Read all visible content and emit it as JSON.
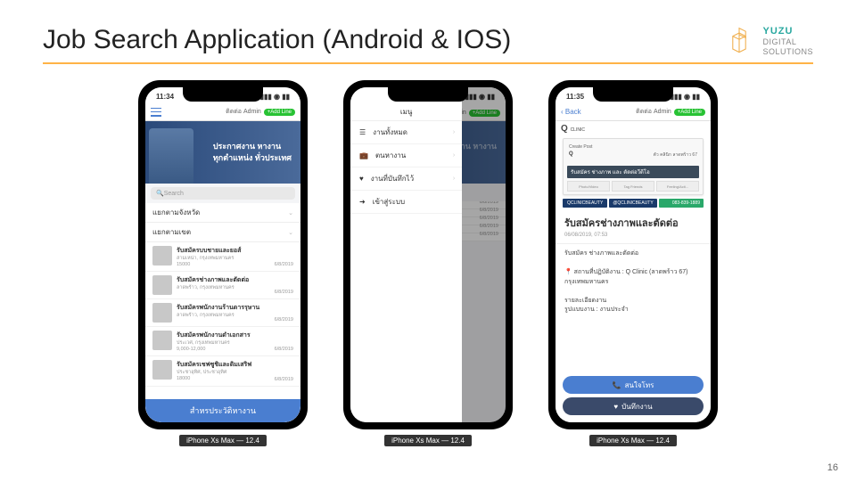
{
  "slide": {
    "title": "Job Search Application (Android & IOS)",
    "page_number": "16"
  },
  "logo": {
    "brand": "YUZU",
    "sub": "DIGITAL\nSOLUTIONS"
  },
  "phone_label": "iPhone Xs Max — 12.4",
  "status": {
    "time1": "11:34",
    "time2": "11:35",
    "time3": "11:35"
  },
  "navbar": {
    "contact": "ติดต่อ Admin",
    "add": "+Add Line",
    "back": "Back",
    "menu_title": "เมนู"
  },
  "hero": {
    "line1": "ประกาศงาน หางาน",
    "line2": "ทุกตำแหน่ง ทั่วประเทศ"
  },
  "search": {
    "placeholder": "Search"
  },
  "filters": {
    "province": "แยกตามจังหวัด",
    "district": "แยกตามเขต"
  },
  "jobs": [
    {
      "title": "รับสมัครบบชายและยอส์",
      "sub": "สามเหน่า, กรุงเทพมหานคร",
      "salary": "15000",
      "date": "6/8/2019"
    },
    {
      "title": "รับสมัครช่างภาพและตัดต่อ",
      "sub": "ลาดพร้าว, กรุงเทพมหานคร",
      "salary": "",
      "date": "6/8/2019"
    },
    {
      "title": "รับสมัครพนักงานร้านดารรุษาน",
      "sub": "ลาดพร้าว, กรุงเทพมหานคร",
      "salary": "",
      "date": "6/8/2019"
    },
    {
      "title": "รับสมัครพนักงานดำเอกสาร",
      "sub": "ประเวศ, กรุงเทพมหานคร",
      "salary": "9,000-12,000",
      "date": "6/8/2019"
    },
    {
      "title": "รับสมัครเชฟซูชิและดิมเสริฟ",
      "sub": "ประชาอุทิศ, ประชาอุทิศ",
      "salary": "18000",
      "date": "6/8/2019"
    }
  ],
  "history_button": "สำหรประวัติหางาน",
  "drawer": {
    "items": [
      {
        "icon": "list",
        "label": "งานทั้งหมด"
      },
      {
        "icon": "briefcase",
        "label": "ตนหางาน"
      },
      {
        "icon": "heart",
        "label": "งานที่บันทึกไว้"
      },
      {
        "icon": "login",
        "label": "เข้าสู่ระบบ"
      }
    ]
  },
  "detail": {
    "brand": "Q",
    "brand_sub": "CLINIC",
    "card_top": "Create Post",
    "card_badge": "ตัว คลินิก ลาดพร้าว 67",
    "card_band": "รับสมัคร ช่างภาพ และ ตัดต่อวีดีโอ",
    "mini": [
      "Photo/Video",
      "Tag Friends",
      "Feeling/Acti..."
    ],
    "tags": [
      "QCLINICBEAUTY",
      "@QCLINICBEAUTY",
      "083-839-1889"
    ],
    "title": "รับสมัครช่างภาพและตัดต่อ",
    "date": "06/08/2019, 07:53",
    "line1": "รับสมัคร ช่างภาพและตัดต่อ",
    "location_label": "สถานที่ปฏิบัติงาน : Q Clinic (ลาดพร้าว 67) กรุงเทพมหานคร",
    "detail_label": "รายละเอียดงาน",
    "type_label": "รูปแบบงาน : งานประจำ",
    "cta_interest": "สนใจโทร",
    "cta_save": "บันทึกงาน"
  }
}
